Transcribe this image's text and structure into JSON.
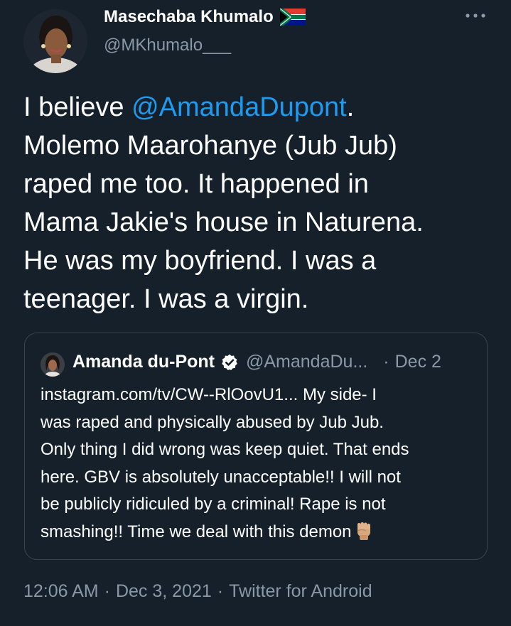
{
  "author": {
    "display_name": "Masechaba Khumalo",
    "handle": "@MKhumalo___",
    "flag_icon": "south-africa-flag-icon"
  },
  "tweet": {
    "line_1_prefix": "I believe ",
    "line_1_mention": "@AmandaDupont",
    "line_1_suffix": ".",
    "line_2": "Molemo Maarohanye (Jub Jub)",
    "line_3": "raped me too. It happened in",
    "line_4": "Mama Jakie's house in Naturena.",
    "line_5": "He was my boyfriend. I was a",
    "line_6": "teenager. I was a virgin."
  },
  "quoted_tweet": {
    "display_name": "Amanda du-Pont",
    "handle": "@AmandaDu...",
    "dot": "·",
    "date": "Dec 2",
    "line_1": "instagram.com/tv/CW--RlOovU1... My side- I",
    "line_2": "was raped and physically abused by Jub Jub.",
    "line_3": "Only thing I did wrong was keep quiet. That ends",
    "line_4": "here. GBV is absolutely unacceptable!! I will not",
    "line_5": "be publicly ridiculed by a criminal! Rape is not",
    "line_6": "smashing!! Time we deal with this demon",
    "emoji_icon": "raised-fist-icon"
  },
  "meta": {
    "time": "12:06 AM",
    "sep_1": "·",
    "date": "Dec 3, 2021",
    "sep_2": "·",
    "source": "Twitter for Android"
  },
  "colors": {
    "background": "#15202b",
    "text": "#ffffff",
    "secondary_text": "#8b98a5",
    "link": "#1d9bf0",
    "border": "#38444d"
  }
}
